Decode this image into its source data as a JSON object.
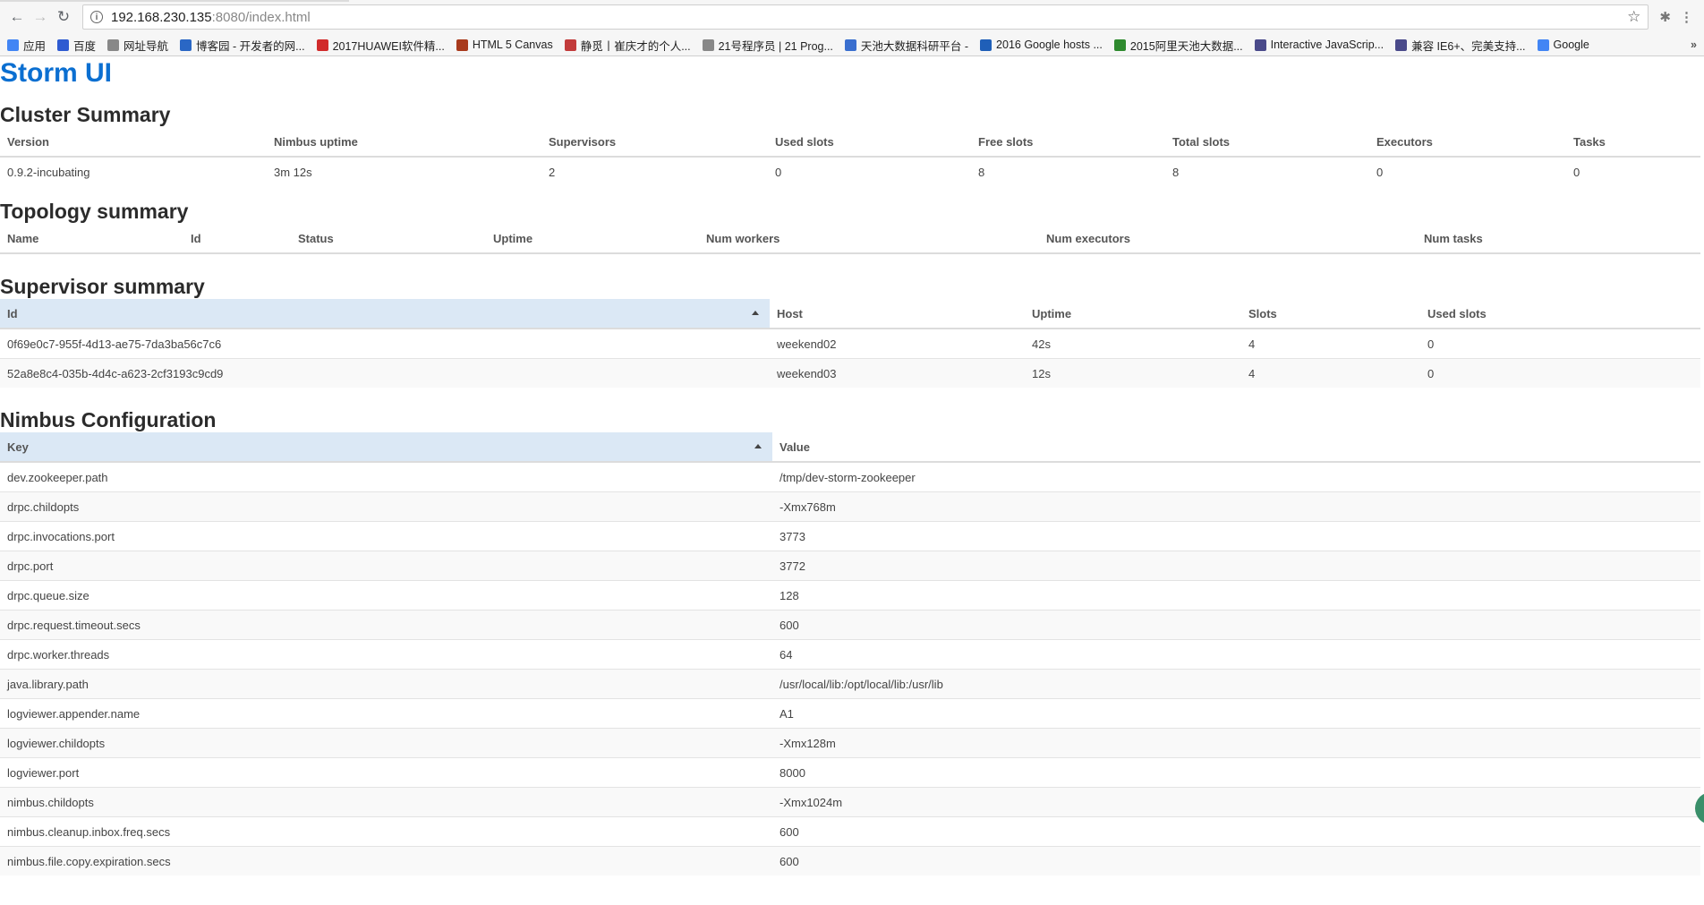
{
  "browser": {
    "url_host": "192.168.230.135",
    "url_path": ":8080/index.html",
    "bookmarks": [
      {
        "label": "应用",
        "icon": "apps-grid-icon",
        "color": "#4285f4"
      },
      {
        "label": "百度",
        "icon": "baidu-icon",
        "color": "#2f5bd1"
      },
      {
        "label": "网址导航",
        "icon": "page-icon",
        "color": "#888888"
      },
      {
        "label": "博客园 - 开发者的网...",
        "icon": "cnblogs-icon",
        "color": "#2a67c5"
      },
      {
        "label": "2017HUAWEI软件精...",
        "icon": "huawei-icon",
        "color": "#d12b2b"
      },
      {
        "label": "HTML 5 Canvas",
        "icon": "b-logo-icon",
        "color": "#a83a1c"
      },
      {
        "label": "静觅丨崔庆才的个人...",
        "icon": "g-logo-icon",
        "color": "#c23b3b"
      },
      {
        "label": "21号程序员 | 21 Prog...",
        "icon": "page-icon",
        "color": "#888888"
      },
      {
        "label": "天池大数据科研平台 -",
        "icon": "t-logo-icon",
        "color": "#3a6fcf"
      },
      {
        "label": "2016 Google hosts ...",
        "icon": "l-logo-icon",
        "color": "#1f5fb8"
      },
      {
        "label": "2015阿里天池大数据...",
        "icon": "w-logo-icon",
        "color": "#2f8a2f"
      },
      {
        "label": "Interactive JavaScrip...",
        "icon": "js-icon",
        "color": "#4a4a8a"
      },
      {
        "label": "兼容 IE6+、完美支持...",
        "icon": "js-icon",
        "color": "#4a4a8a"
      },
      {
        "label": "Google",
        "icon": "google-icon",
        "color": "#4285f4"
      }
    ],
    "more": "»"
  },
  "page": {
    "title": "Storm UI",
    "cluster": {
      "heading": "Cluster Summary",
      "columns": [
        "Version",
        "Nimbus uptime",
        "Supervisors",
        "Used slots",
        "Free slots",
        "Total slots",
        "Executors",
        "Tasks"
      ],
      "row": [
        "0.9.2-incubating",
        "3m 12s",
        "2",
        "0",
        "8",
        "8",
        "0",
        "0"
      ]
    },
    "topology": {
      "heading": "Topology summary",
      "columns": [
        "Name",
        "Id",
        "Status",
        "Uptime",
        "Num workers",
        "Num executors",
        "Num tasks"
      ]
    },
    "supervisor": {
      "heading": "Supervisor summary",
      "columns": [
        "Id",
        "Host",
        "Uptime",
        "Slots",
        "Used slots"
      ],
      "rows": [
        [
          "0f69e0c7-955f-4d13-ae75-7da3ba56c7c6",
          "weekend02",
          "42s",
          "4",
          "0"
        ],
        [
          "52a8e8c4-035b-4d4c-a623-2cf3193c9cd9",
          "weekend03",
          "12s",
          "4",
          "0"
        ]
      ]
    },
    "nimbus": {
      "heading": "Nimbus Configuration",
      "columns": [
        "Key",
        "Value"
      ],
      "rows": [
        [
          "dev.zookeeper.path",
          "/tmp/dev-storm-zookeeper"
        ],
        [
          "drpc.childopts",
          "-Xmx768m"
        ],
        [
          "drpc.invocations.port",
          "3773"
        ],
        [
          "drpc.port",
          "3772"
        ],
        [
          "drpc.queue.size",
          "128"
        ],
        [
          "drpc.request.timeout.secs",
          "600"
        ],
        [
          "drpc.worker.threads",
          "64"
        ],
        [
          "java.library.path",
          "/usr/local/lib:/opt/local/lib:/usr/lib"
        ],
        [
          "logviewer.appender.name",
          "A1"
        ],
        [
          "logviewer.childopts",
          "-Xmx128m"
        ],
        [
          "logviewer.port",
          "8000"
        ],
        [
          "nimbus.childopts",
          "-Xmx1024m"
        ],
        [
          "nimbus.cleanup.inbox.freq.secs",
          "600"
        ],
        [
          "nimbus.file.copy.expiration.secs",
          "600"
        ]
      ]
    }
  }
}
